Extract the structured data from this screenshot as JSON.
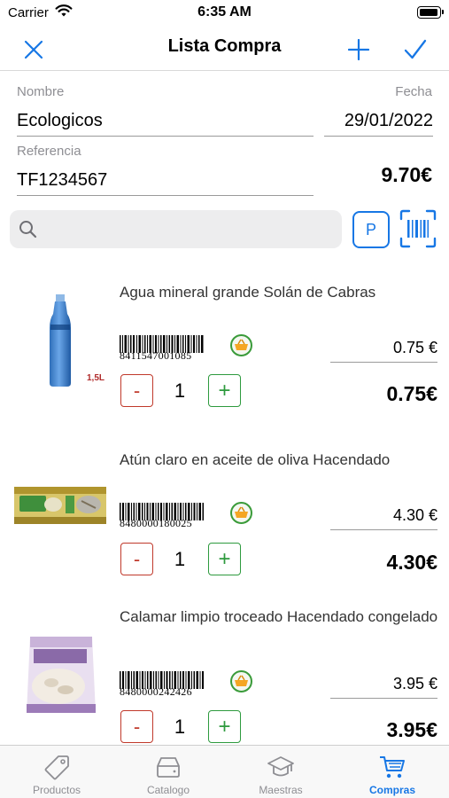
{
  "status_bar": {
    "carrier": "Carrier",
    "time": "6:35 AM"
  },
  "navbar": {
    "title": "Lista Compra",
    "close_icon": "close-icon",
    "add_icon": "plus-icon",
    "confirm_icon": "checkmark-icon"
  },
  "form": {
    "nombre_label": "Nombre",
    "nombre_value": "Ecologicos",
    "fecha_label": "Fecha",
    "fecha_value": "29/01/2022",
    "referencia_label": "Referencia",
    "referencia_value": "TF1234567",
    "total": "9.70€"
  },
  "search": {
    "placeholder": "",
    "p_button_label": "P",
    "scan_icon": "barcode-scan-icon"
  },
  "items": [
    {
      "name": "Agua mineral grande Solán de Cabras",
      "barcode": "8411547001085",
      "size_tag": "1,5L",
      "price": "0.75 €",
      "quantity": "1",
      "subtotal": "0.75€",
      "minus_label": "-",
      "plus_label": "+"
    },
    {
      "name": "Atún claro en aceite de oliva Hacendado",
      "barcode": "8480000180025",
      "price": "4.30 €",
      "quantity": "1",
      "subtotal": "4.30€",
      "minus_label": "-",
      "plus_label": "+"
    },
    {
      "name": "Calamar limpio troceado Hacendado congelado",
      "barcode": "8480000242426",
      "price": "3.95 €",
      "quantity": "1",
      "subtotal": "3.95€",
      "minus_label": "-",
      "plus_label": "+"
    }
  ],
  "tabbar": {
    "tabs": [
      {
        "label": "Productos",
        "icon": "tag-icon"
      },
      {
        "label": "Catalogo",
        "icon": "drive-icon"
      },
      {
        "label": "Maestras",
        "icon": "graduation-cap-icon"
      },
      {
        "label": "Compras",
        "icon": "cart-icon",
        "active": true
      }
    ]
  },
  "colors": {
    "accent": "#1777e5",
    "minus": "#c0392b",
    "plus": "#2e9a3e"
  }
}
